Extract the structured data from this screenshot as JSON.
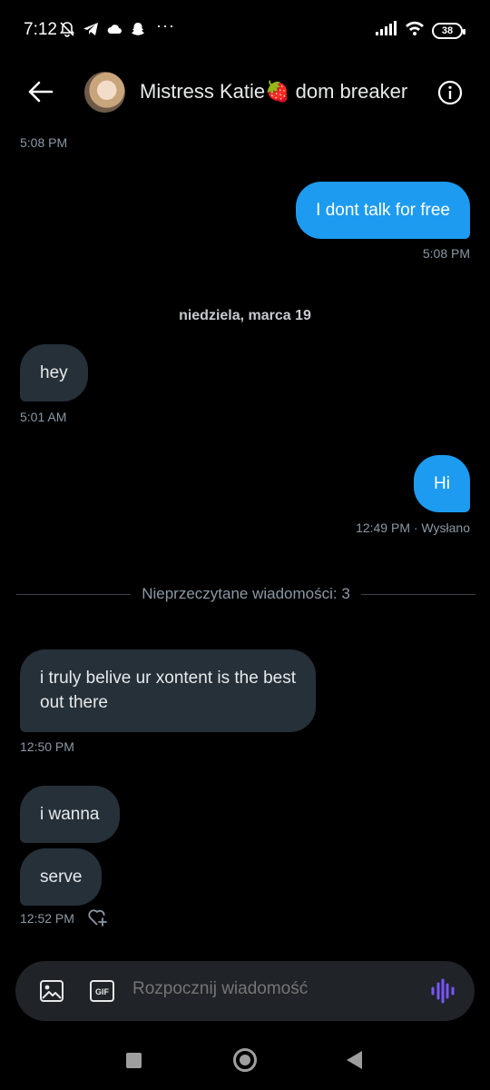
{
  "status": {
    "time": "7:12",
    "more": "···",
    "battery": "38"
  },
  "header": {
    "title": "Mistress Katie🍓 dom breaker"
  },
  "messages": {
    "ts_top": "5:08 PM",
    "out1": {
      "text": "I dont talk for free",
      "time": "5:08 PM"
    },
    "date_separator": "niedziela, marca 19",
    "in1": {
      "text": "hey",
      "time": "5:01 AM"
    },
    "out2": {
      "text": "Hi",
      "time": "12:49 PM · Wysłano"
    },
    "unread_separator": "Nieprzeczytane wiadomości: 3",
    "in2": {
      "line1": "i truly belive ur xontent is the best",
      "line2": "out there",
      "time": "12:50 PM"
    },
    "in3": {
      "text": "i wanna"
    },
    "in4": {
      "text": "serve",
      "time": "12:52 PM"
    }
  },
  "composer": {
    "placeholder": "Rozpocznij wiadomość",
    "gif_label": "GIF"
  },
  "colors": {
    "accent": "#1d9bf0",
    "voice": "#7856ff",
    "incoming_bubble": "#253039"
  }
}
